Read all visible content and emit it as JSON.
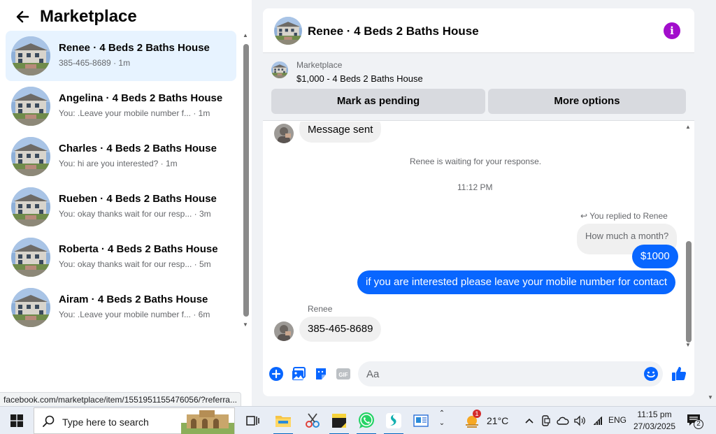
{
  "left": {
    "title": "Marketplace",
    "conversations": [
      {
        "name": "Renee · 4 Beds 2 Baths House",
        "snippet": "385-465-8689 · 1m"
      },
      {
        "name": "Angelina · 4 Beds 2 Baths House",
        "snippet": "You: .Leave your mobile number f...  · 1m"
      },
      {
        "name": "Charles · 4 Beds 2 Baths House",
        "snippet": "You: hi are you interested? · 1m"
      },
      {
        "name": "Rueben · 4 Beds 2 Baths House",
        "snippet": "You: okay thanks wait for our resp... · 3m"
      },
      {
        "name": "Roberta · 4 Beds 2 Baths House",
        "snippet": "You: okay thanks wait for our resp... · 5m"
      },
      {
        "name": "Airam · 4 Beds 2 Baths House",
        "snippet": "You: .Leave your mobile number f...  · 6m"
      }
    ],
    "status_url": "facebook.com/marketplace/item/1551951155476056/?referra..."
  },
  "chat": {
    "title": "Renee · 4 Beds 2 Baths House",
    "listing": {
      "label": "Marketplace",
      "price_title": "$1,000 - 4 Beds 2 Baths House",
      "mark_pending": "Mark as pending",
      "more_options": "More options"
    },
    "messages": {
      "message_sent": "Message sent",
      "waiting": "Renee is waiting for your response.",
      "time": "11:12 PM",
      "replied_to": "You replied to Renee",
      "quoted": "How much a month?",
      "reply1": "$1000",
      "reply2": "if you are interested please leave your mobile number for contact",
      "sender": "Renee",
      "incoming": "385-465-8689"
    },
    "composer": {
      "placeholder": "Aa"
    }
  },
  "taskbar": {
    "search_placeholder": "Type here to search",
    "weather_temp": "21°C",
    "weather_badge": "1",
    "language": "ENG",
    "time": "11:15 pm",
    "date": "27/03/2025",
    "notification_count": "2"
  },
  "colors": {
    "accent_blue": "#0866ff",
    "info_purple": "#a20dcc",
    "active_row": "#e7f3ff"
  }
}
